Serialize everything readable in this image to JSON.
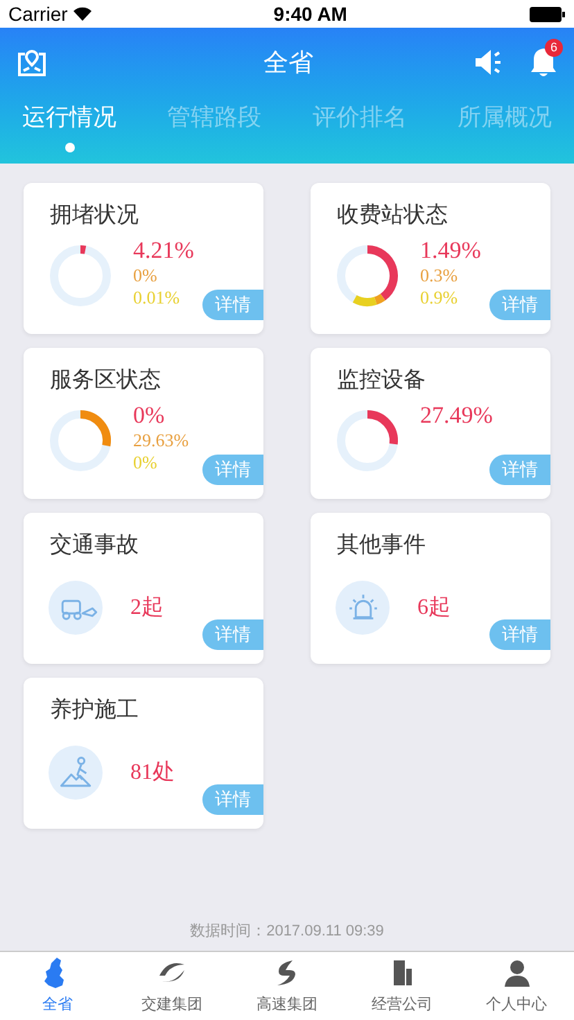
{
  "status_bar": {
    "carrier": "Carrier",
    "time": "9:40 AM"
  },
  "header": {
    "title": "全省",
    "notification_badge": "6"
  },
  "tabs": [
    {
      "label": "运行情况",
      "selected": true
    },
    {
      "label": "管辖路段",
      "selected": false
    },
    {
      "label": "评价排名",
      "selected": false
    },
    {
      "label": "所属概况",
      "selected": false
    }
  ],
  "cards": [
    {
      "kind": "donut",
      "title": "拥堵状况",
      "segments": [
        {
          "color": "#e8385a"
        }
      ],
      "stats": [
        {
          "text": "4.21%",
          "color": "#e8385a"
        },
        {
          "text": "0%",
          "color": "#e8a040"
        },
        {
          "text": "0.01%",
          "color": "#e8d030"
        }
      ],
      "button": "详情"
    },
    {
      "kind": "donut",
      "title": "收费站状态",
      "segments": [
        {
          "color": "#e8385a"
        },
        {
          "color": "#f0a020"
        },
        {
          "color": "#e8d020"
        }
      ],
      "stats": [
        {
          "text": "1.49%",
          "color": "#e8385a"
        },
        {
          "text": "0.3%",
          "color": "#e8a040"
        },
        {
          "text": "0.9%",
          "color": "#e8d030"
        }
      ],
      "button": "详情"
    },
    {
      "kind": "donut",
      "title": "服务区状态",
      "segments": [
        {
          "color": "#f08c10"
        }
      ],
      "stats": [
        {
          "text": "0%",
          "color": "#e8385a"
        },
        {
          "text": "29.63%",
          "color": "#e8a040"
        },
        {
          "text": "0%",
          "color": "#e8d030"
        }
      ],
      "button": "详情"
    },
    {
      "kind": "donut",
      "title": "监控设备",
      "segments": [
        {
          "color": "#e8385a"
        }
      ],
      "stats": [
        {
          "text": "27.49%",
          "color": "#e8385a"
        }
      ],
      "button": "详情"
    },
    {
      "kind": "crash",
      "title": "交通事故",
      "value": "2起",
      "button": "详情"
    },
    {
      "kind": "siren",
      "title": "其他事件",
      "value": "6起",
      "button": "详情"
    },
    {
      "kind": "worker",
      "title": "养护施工",
      "value": "81处",
      "button": "详情"
    }
  ],
  "data_time": "数据时间：2017.09.11 09:39",
  "bottom_nav": [
    {
      "label": "全省",
      "kind": "map",
      "selected": true
    },
    {
      "label": "交建集团",
      "kind": "swoosh",
      "selected": false
    },
    {
      "label": "高速集团",
      "kind": "s-logo",
      "selected": false
    },
    {
      "label": "经营公司",
      "kind": "building",
      "selected": false
    },
    {
      "label": "个人中心",
      "kind": "person",
      "selected": false
    }
  ]
}
